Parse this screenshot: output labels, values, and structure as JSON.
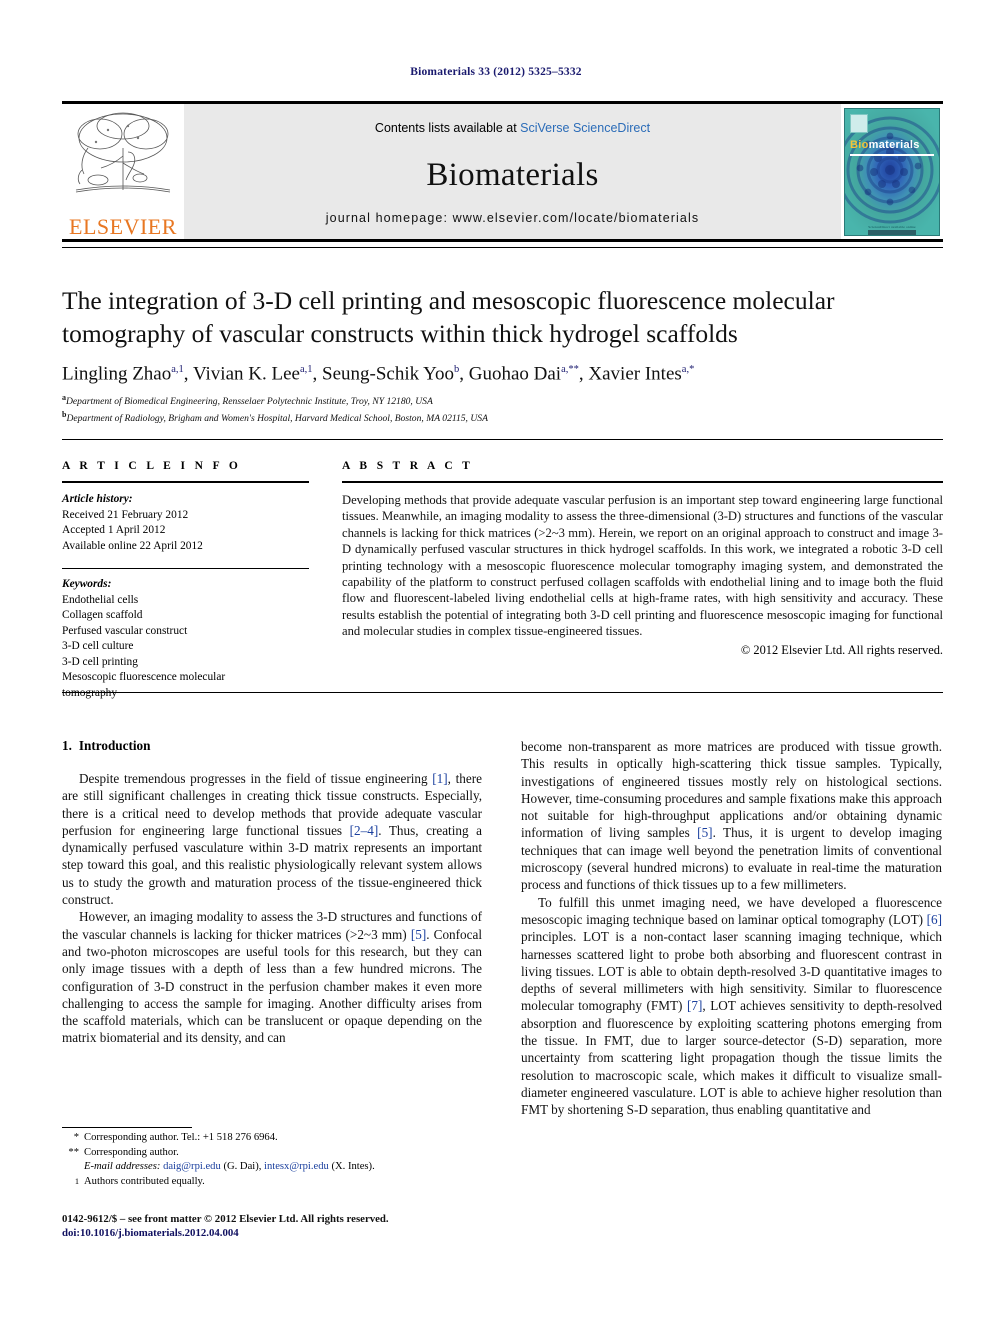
{
  "running_head": "Biomaterials 33 (2012) 5325–5332",
  "masthead": {
    "contents_prefix": "Contents lists available at ",
    "contents_link": "SciVerse ScienceDirect",
    "journal_name": "Biomaterials",
    "homepage": "journal homepage: www.elsevier.com/locate/biomaterials",
    "publisher_logo_text": "ELSEVIER",
    "cover": {
      "title_part1": "Bio",
      "title_part2": "materials",
      "footer_text": "ScienceDirect available online"
    }
  },
  "article": {
    "title": "The integration of 3-D cell printing and mesoscopic fluorescence molecular tomography of vascular constructs within thick hydrogel scaffolds",
    "authors": [
      {
        "name": "Lingling Zhao",
        "marks": "a,1",
        "sep": ", "
      },
      {
        "name": "Vivian K. Lee",
        "marks": "a,1",
        "sep": ", "
      },
      {
        "name": "Seung-Schik Yoo",
        "marks": "b",
        "sep": ", "
      },
      {
        "name": "Guohao Dai",
        "marks": "a,**",
        "sep": ", "
      },
      {
        "name": "Xavier Intes",
        "marks": "a,*",
        "sep": ""
      }
    ],
    "affiliations": [
      {
        "mark": "a",
        "text": "Department of Biomedical Engineering, Rensselaer Polytechnic Institute, Troy, NY 12180, USA"
      },
      {
        "mark": "b",
        "text": "Department of Radiology, Brigham and Women's Hospital, Harvard Medical School, Boston, MA 02115, USA"
      }
    ]
  },
  "article_info": {
    "heading": "A R T I C L E   I N F O",
    "history_title": "Article history:",
    "history": [
      "Received 21 February 2012",
      "Accepted 1 April 2012",
      "Available online 22 April 2012"
    ],
    "keywords_title": "Keywords:",
    "keywords": [
      "Endothelial cells",
      "Collagen scaffold",
      "Perfused vascular construct",
      "3-D cell culture",
      "3-D cell printing",
      "Mesoscopic fluorescence molecular",
      "tomography"
    ]
  },
  "abstract": {
    "heading": "A B S T R A C T",
    "text": "Developing methods that provide adequate vascular perfusion is an important step toward engineering large functional tissues. Meanwhile, an imaging modality to assess the three-dimensional (3-D) structures and functions of the vascular channels is lacking for thick matrices (>2~3 mm). Herein, we report on an original approach to construct and image 3-D dynamically perfused vascular structures in thick hydrogel scaffolds. In this work, we integrated a robotic 3-D cell printing technology with a mesoscopic fluorescence molecular tomography imaging system, and demonstrated the capability of the platform to construct perfused collagen scaffolds with endothelial lining and to image both the fluid flow and fluorescent-labeled living endothelial cells at high-frame rates, with high sensitivity and accuracy. These results establish the potential of integrating both 3-D cell printing and fluorescence mesoscopic imaging for functional and molecular studies in complex tissue-engineered tissues.",
    "copyright": "© 2012 Elsevier Ltd. All rights reserved."
  },
  "introduction": {
    "number": "1.",
    "heading": "Introduction",
    "left_paragraphs": [
      {
        "parts": [
          {
            "t": "Despite tremendous progresses in the field of tissue engineering "
          },
          {
            "t": "[1]",
            "ref": true
          },
          {
            "t": ", there are still significant challenges in creating thick tissue constructs. Especially, there is a critical need to develop methods that provide adequate vascular perfusion for engineering large functional tissues "
          },
          {
            "t": "[2–4]",
            "ref": true
          },
          {
            "t": ". Thus, creating a dynamically perfused vasculature within 3-D matrix represents an important step toward this goal, and this realistic physiologically relevant system allows us to study the growth and maturation process of the tissue-engineered thick construct."
          }
        ]
      },
      {
        "parts": [
          {
            "t": "However, an imaging modality to assess the 3-D structures and functions of the vascular channels is lacking for thicker matrices (>2~3 mm) "
          },
          {
            "t": "[5]",
            "ref": true
          },
          {
            "t": ". Confocal and two-photon microscopes are useful tools for this research, but they can only image tissues with a depth of less than a few hundred microns. The configuration of 3-D construct in the perfusion chamber makes it even more challenging to access the sample for imaging. Another difficulty arises from the scaffold materials, which can be translucent or opaque depending on the matrix biomaterial and its density, and can"
          }
        ]
      }
    ],
    "right_paragraphs": [
      {
        "continuation": true,
        "parts": [
          {
            "t": "become non-transparent as more matrices are produced with tissue growth. This results in optically high-scattering thick tissue samples. Typically, investigations of engineered tissues mostly rely on histological sections. However, time-consuming procedures and sample fixations make this approach not suitable for high-throughput applications and/or obtaining dynamic information of living samples "
          },
          {
            "t": "[5]",
            "ref": true
          },
          {
            "t": ". Thus, it is urgent to develop imaging techniques that can image well beyond the penetration limits of conventional microscopy (several hundred microns) to evaluate in real-time the maturation process and functions of thick tissues up to a few millimeters."
          }
        ]
      },
      {
        "continuation": false,
        "parts": [
          {
            "t": "To fulfill this unmet imaging need, we have developed a fluorescence mesoscopic imaging technique based on laminar optical tomography (LOT) "
          },
          {
            "t": "[6]",
            "ref": true
          },
          {
            "t": " principles. LOT is a non-contact laser scanning imaging technique, which harnesses scattered light to probe both absorbing and fluorescent contrast in living tissues. LOT is able to obtain depth-resolved 3-D quantitative images to depths of several millimeters with high sensitivity. Similar to fluorescence molecular tomography (FMT) "
          },
          {
            "t": "[7]",
            "ref": true
          },
          {
            "t": ", LOT achieves sensitivity to depth-resolved absorption and fluorescence by exploiting scattering photons emerging from the tissue. In FMT, due to larger source-detector (S-D) separation, more uncertainty from scattering light propagation though the tissue limits the resolution to macroscopic scale, which makes it difficult to visualize small-diameter engineered vasculature. LOT is able to achieve higher resolution than FMT by shortening S-D separation, thus enabling quantitative and"
          }
        ]
      }
    ]
  },
  "footnotes": {
    "corresponding_1_mark": "*",
    "corresponding_1_text": "Corresponding author. Tel.: +1 518 276 6964.",
    "corresponding_2_mark": "**",
    "corresponding_2_text": "Corresponding author.",
    "email_label": "E-mail addresses:",
    "email_1": "daig@rpi.edu",
    "email_1_who": "(G. Dai)",
    "email_2": "intesx@rpi.edu",
    "email_2_who": "(X. Intes)",
    "equal_mark": "1",
    "equal_text": "Authors contributed equally."
  },
  "footer": {
    "issn_line": "0142-9612/$ – see front matter © 2012 Elsevier Ltd. All rights reserved.",
    "doi_line": "doi:10.1016/j.biomaterials.2012.04.004"
  },
  "colors": {
    "running_head": "#1a1a6e",
    "link": "#2b6cb8",
    "reference": "#1a3f9e",
    "elsevier_orange": "#E87722",
    "masthead_gray": "#e9e9e9",
    "cover_teal": "#3fa8a2"
  }
}
